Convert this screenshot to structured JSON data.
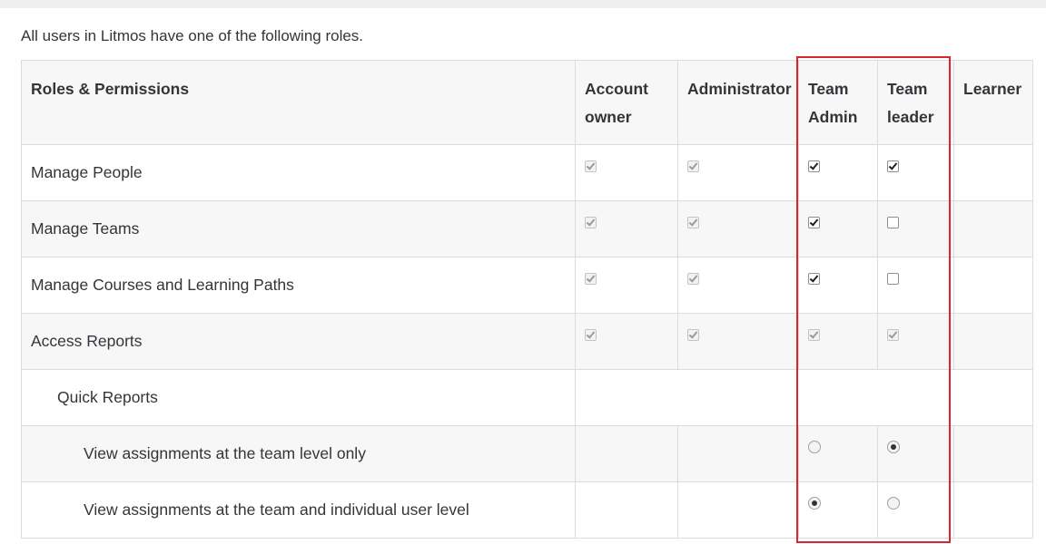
{
  "intro": "All users in Litmos have one of the following roles.",
  "header": {
    "roles_permissions": "Roles & Permissions",
    "account_owner_line1": "Account",
    "account_owner_line2": "owner",
    "administrator": "Administrator",
    "team_admin_line1": "Team",
    "team_admin_line2": "Admin",
    "team_leader_line1": "Team",
    "team_leader_line2": "leader",
    "learner": "Learner"
  },
  "rows": [
    {
      "label": "Manage People",
      "account_owner": "checked-disabled",
      "administrator": "checked-disabled",
      "team_admin": "checked",
      "team_leader": "checked",
      "learner": "none"
    },
    {
      "label": "Manage Teams",
      "account_owner": "checked-disabled",
      "administrator": "checked-disabled",
      "team_admin": "checked",
      "team_leader": "unchecked",
      "learner": "none"
    },
    {
      "label": "Manage Courses and Learning Paths",
      "account_owner": "checked-disabled",
      "administrator": "checked-disabled",
      "team_admin": "checked",
      "team_leader": "unchecked",
      "learner": "none"
    },
    {
      "label": "Access Reports",
      "account_owner": "checked-disabled",
      "administrator": "checked-disabled",
      "team_admin": "checked-disabled",
      "team_leader": "checked-disabled",
      "learner": "none"
    },
    {
      "label": "Quick Reports"
    },
    {
      "label": "View assignments at the team level only",
      "team_admin": "radio-unselected",
      "team_leader": "radio-selected"
    },
    {
      "label": "View assignments at the team and individual user level",
      "team_admin": "radio-selected",
      "team_leader": "radio-unselected"
    }
  ],
  "colors": {
    "highlight": "#d9262c",
    "header_bg": "#f7f7f7",
    "border": "#dcdcdc"
  }
}
